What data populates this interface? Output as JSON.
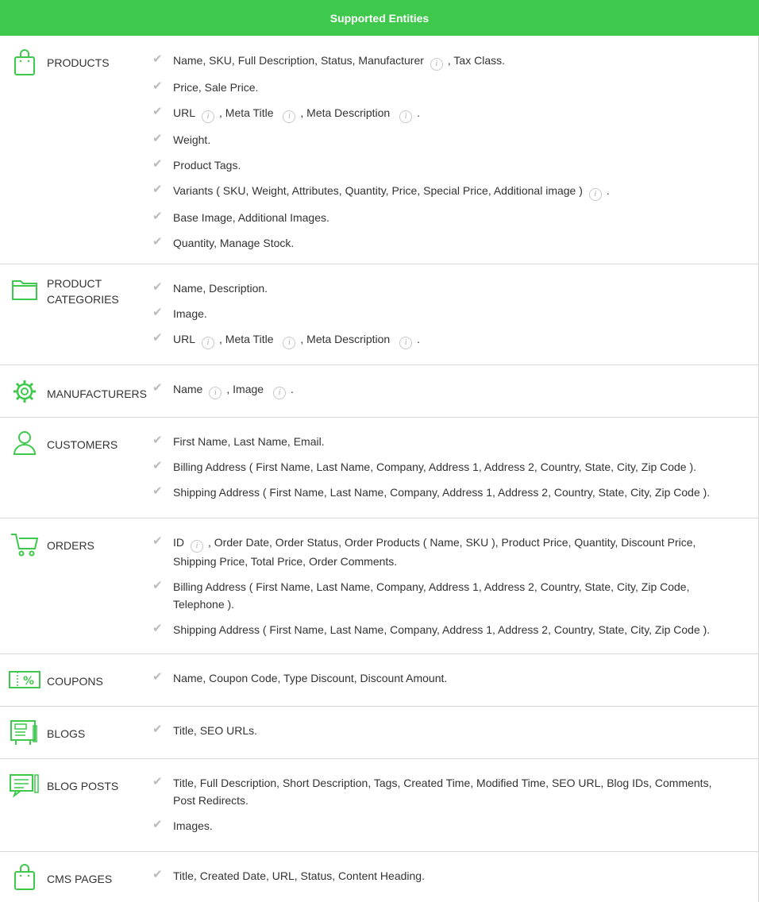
{
  "header": {
    "title": "Supported Entities"
  },
  "colors": {
    "accent": "#3ec94d",
    "check": "#bbbbbb",
    "divider": "#d8d8d8"
  },
  "info_glyph": "i",
  "rows": [
    {
      "label": "PRODUCTS",
      "icon": "shopping-bag-icon",
      "items": [
        "Name, SKU, Full Description, Status, Manufacturer [i], Tax Class.",
        "Price, Sale Price.",
        "URL [i], Meta Title [i], Meta Description [i].",
        "Weight.",
        "Product Tags.",
        "Variants ( SKU, Weight, Attributes, Quantity, Price, Special Price, Additional image ) [i].",
        "Base Image, Additional Images.",
        "Quantity, Manage Stock."
      ]
    },
    {
      "label": "PRODUCT CATEGORIES",
      "icon": "folder-icon",
      "items": [
        "Name, Description.",
        "Image.",
        "URL [i], Meta Title [i], Meta Description [i]."
      ]
    },
    {
      "label": "MANUFACTURERS",
      "icon": "gear-icon",
      "items": [
        "Name [i], Image [i]."
      ]
    },
    {
      "label": "CUSTOMERS",
      "icon": "user-icon",
      "items": [
        "First Name, Last Name, Email.",
        "Billing Address ( First Name, Last Name, Company, Address 1, Address 2, Country, State, City, Zip Code ).",
        "Shipping Address ( First Name, Last Name, Company, Address 1, Address 2, Country, State, City, Zip Code )."
      ]
    },
    {
      "label": "ORDERS",
      "icon": "cart-icon",
      "items": [
        "ID [i], Order Date, Order Status, Order Products ( Name, SKU ), Product Price, Quantity, Discount Price, Shipping Price, Total Price, Order Comments.",
        "Billing Address ( First Name, Last Name, Company, Address 1, Address 2, Country, State, City, Zip Code, Telephone ).",
        "Shipping Address ( First Name, Last Name, Company, Address 1, Address 2, Country, State, City, Zip Code )."
      ]
    },
    {
      "label": "COUPONS",
      "icon": "coupon-icon",
      "items": [
        "Name, Coupon Code, Type Discount, Discount Amount."
      ]
    },
    {
      "label": "BLOGS",
      "icon": "blog-icon",
      "items": [
        "Title, SEO URLs."
      ]
    },
    {
      "label": "BLOG POSTS",
      "icon": "blog-post-icon",
      "items": [
        "Title, Full Description, Short Description, Tags, Created Time, Modified Time, SEO URL, Blog IDs, Comments, Post Redirects.",
        "Images."
      ]
    },
    {
      "label": "CMS PAGES",
      "icon": "cms-bag-icon",
      "items": [
        "Title, Created Date, URL, Status, Content Heading."
      ]
    }
  ]
}
